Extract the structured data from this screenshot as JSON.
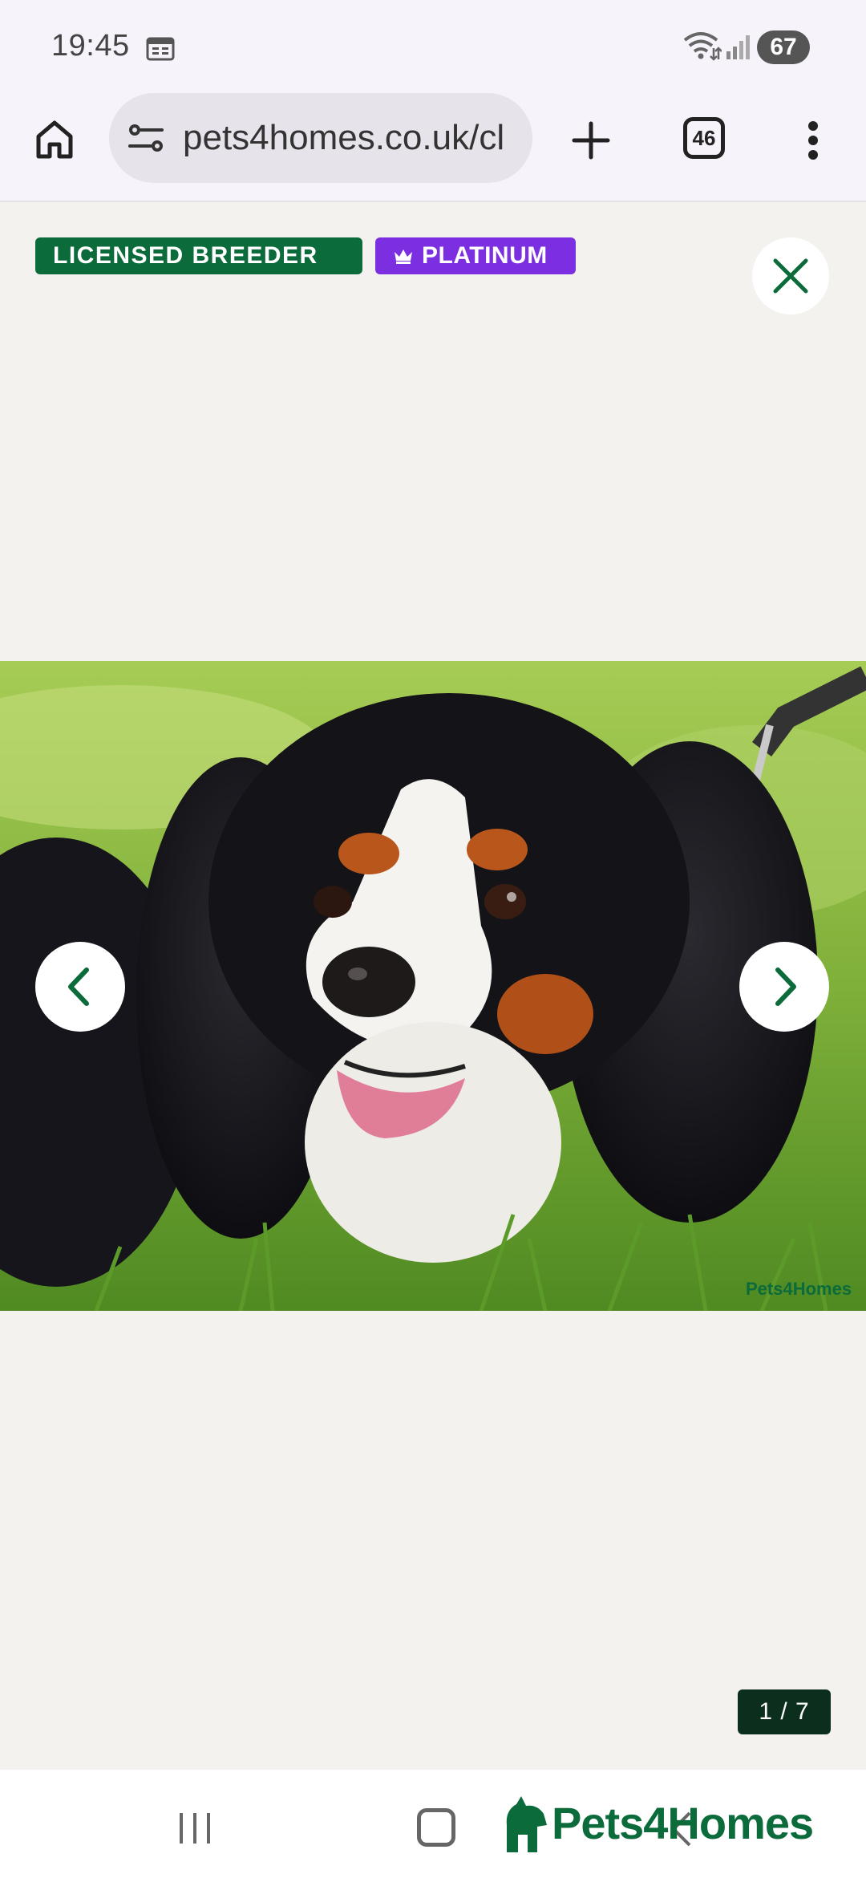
{
  "status_bar": {
    "time": "19:45",
    "battery": "67",
    "icons": [
      "calendar-icon",
      "wifi-icon",
      "signal-icon"
    ]
  },
  "browser": {
    "url": "pets4homes.co.uk/cl",
    "tab_count": "46",
    "icons": [
      "home-icon",
      "site-settings-icon",
      "plus-icon",
      "tabs-icon",
      "more-vert-icon"
    ]
  },
  "gallery": {
    "badges": {
      "licensed": "LICENSED BREEDER",
      "platinum": "PLATINUM"
    },
    "counter": "1 / 7",
    "photo_watermark": "Pets4Homes",
    "icons": [
      "close-icon",
      "chevron-left-icon",
      "chevron-right-icon",
      "crown-icon"
    ]
  },
  "system_nav": {
    "brand": "Pets4Homes",
    "icons": [
      "recent-apps-icon",
      "home-button-icon",
      "back-icon"
    ]
  },
  "colors": {
    "brand_green": "#0c6b3b",
    "platinum_purple": "#7b2fe0",
    "counter_bg": "#0b2f1c",
    "viewer_bg": "#f3f2ee"
  }
}
